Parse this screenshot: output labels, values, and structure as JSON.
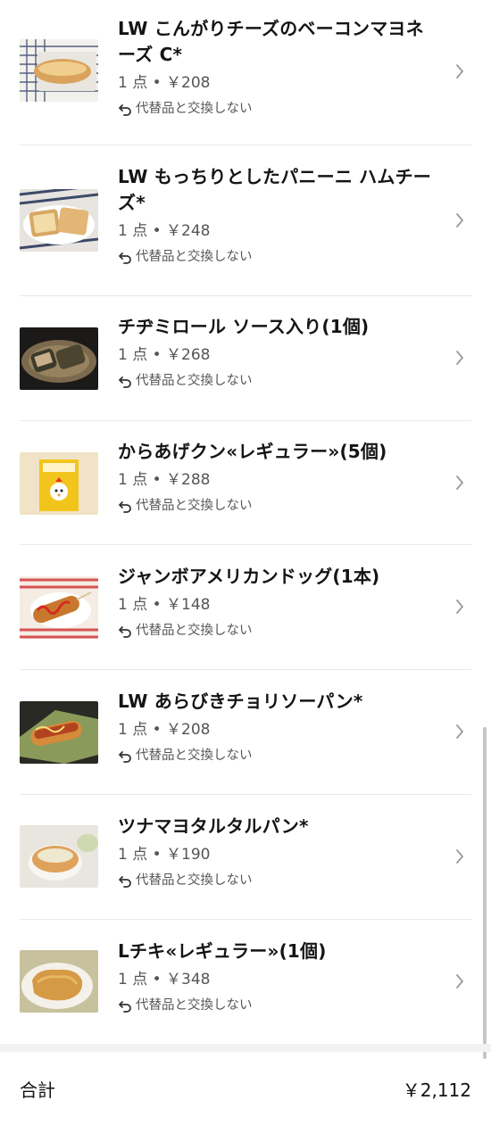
{
  "items": [
    {
      "name": "LW こんがりチーズのベーコンマヨネーズ C*",
      "qty_price": "1 点 • ￥208",
      "substitution": "代替品と交換しない",
      "thumb_icon": "bread-roll-photo"
    },
    {
      "name": "LW もっちりとしたパニーニ ハムチーズ*",
      "qty_price": "1 点 • ￥248",
      "substitution": "代替品と交換しない",
      "thumb_icon": "panini-photo"
    },
    {
      "name": "チヂミロール ソース入り(1個)",
      "qty_price": "1 点 • ￥268",
      "substitution": "代替品と交換しない",
      "thumb_icon": "chijimi-roll-photo"
    },
    {
      "name": "からあげクン«レギュラー»(5個)",
      "qty_price": "1 点 • ￥288",
      "substitution": "代替品と交換しない",
      "thumb_icon": "karaage-box-photo"
    },
    {
      "name": "ジャンボアメリカンドッグ(1本)",
      "qty_price": "1 点 • ￥148",
      "substitution": "代替品と交換しない",
      "thumb_icon": "corn-dog-photo"
    },
    {
      "name": "LW あらびきチョリソーパン*",
      "qty_price": "1 点 • ￥208",
      "substitution": "代替品と交換しない",
      "thumb_icon": "sausage-bread-photo"
    },
    {
      "name": "ツナマヨタルタルパン*",
      "qty_price": "1 点 • ￥190",
      "substitution": "代替品と交換しない",
      "thumb_icon": "tuna-bread-photo"
    },
    {
      "name": "Lチキ«レギュラー»(1個)",
      "qty_price": "1 点 • ￥348",
      "substitution": "代替品と交換しない",
      "thumb_icon": "fried-chicken-photo"
    }
  ],
  "total": {
    "label": "合計",
    "value": "￥2,112"
  },
  "colors": {
    "text": "#141414",
    "secondary": "#555555",
    "divider": "#e8e8e8",
    "chevron": "#9a9a9a"
  }
}
